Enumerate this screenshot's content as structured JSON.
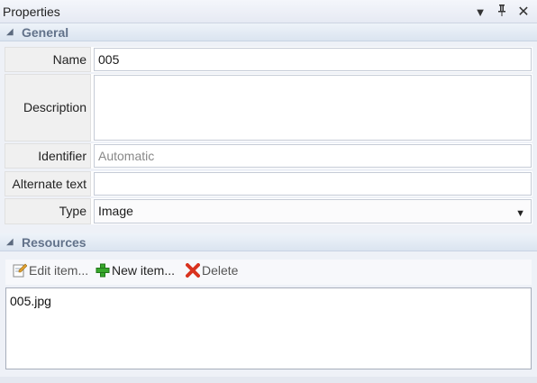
{
  "panel": {
    "title": "Properties",
    "controls": {
      "dropdown_icon": "dropdown-arrow-icon",
      "pin_icon": "pin-icon",
      "close_icon": "close-icon"
    }
  },
  "general": {
    "header": "General",
    "fields": {
      "name": {
        "label": "Name",
        "value": "005"
      },
      "description": {
        "label": "Description",
        "value": ""
      },
      "identifier": {
        "label": "Identifier",
        "placeholder": "Automatic"
      },
      "alternate_text": {
        "label": "Alternate text",
        "value": ""
      },
      "type": {
        "label": "Type",
        "value": "Image"
      }
    }
  },
  "resources": {
    "header": "Resources",
    "toolbar": {
      "edit_label": "Edit item...",
      "new_label": "New item...",
      "delete_label": "Delete"
    },
    "items": [
      "005.jpg"
    ]
  },
  "colors": {
    "section_text": "#62728a",
    "new_icon": "#37a82b",
    "delete_icon": "#d8321e"
  }
}
